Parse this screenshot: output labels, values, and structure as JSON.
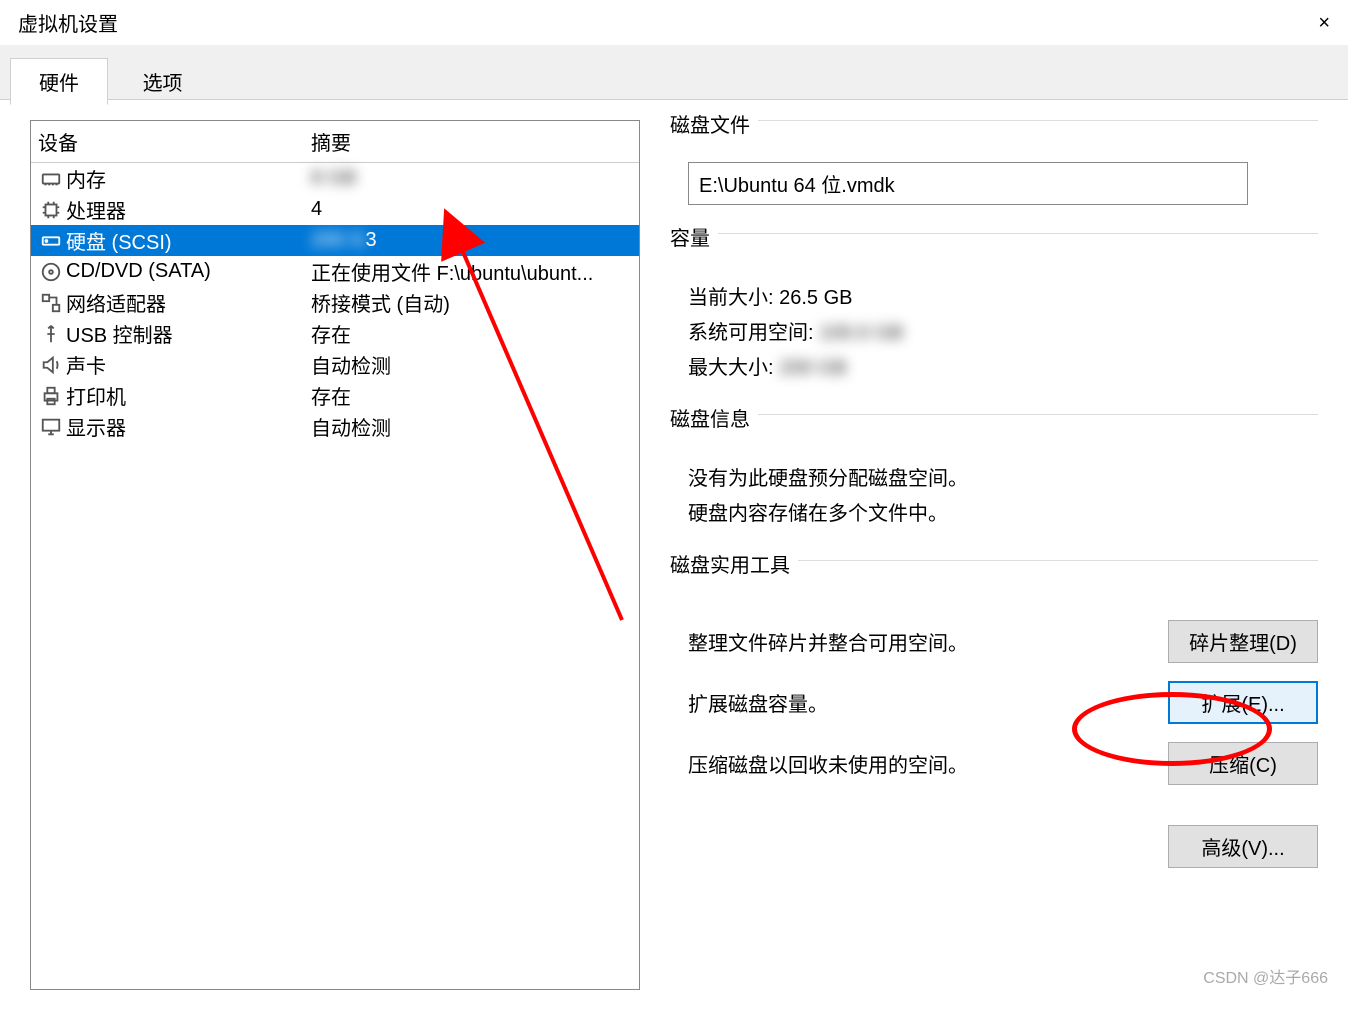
{
  "window": {
    "title": "虚拟机设置"
  },
  "tabs": {
    "hardware": "硬件",
    "options": "选项"
  },
  "devlist": {
    "header_device": "设备",
    "header_summary": "摘要",
    "items": [
      {
        "name": "内存",
        "summary": ""
      },
      {
        "name": "处理器",
        "summary": "4"
      },
      {
        "name": "硬盘 (SCSI)",
        "summary": "3"
      },
      {
        "name": "CD/DVD (SATA)",
        "summary": "正在使用文件 F:\\ubuntu\\ubunt..."
      },
      {
        "name": "网络适配器",
        "summary": "桥接模式 (自动)"
      },
      {
        "name": "USB 控制器",
        "summary": "存在"
      },
      {
        "name": "声卡",
        "summary": "自动检测"
      },
      {
        "name": "打印机",
        "summary": "存在"
      },
      {
        "name": "显示器",
        "summary": "自动检测"
      }
    ]
  },
  "right": {
    "disk_file_label": "磁盘文件",
    "disk_file_value": "E:\\Ubuntu 64 位.vmdk",
    "capacity_label": "容量",
    "cur_size_label": "当前大小:",
    "cur_size_value": "26.5 GB",
    "free_label": "系统可用空间:",
    "free_value": "",
    "max_label": "最大大小:",
    "max_value": "",
    "info_label": "磁盘信息",
    "info_line1": "没有为此硬盘预分配磁盘空间。",
    "info_line2": "硬盘内容存储在多个文件中。",
    "util_label": "磁盘实用工具",
    "util_defrag_desc": "整理文件碎片并整合可用空间。",
    "util_defrag_btn": "碎片整理(D)",
    "util_expand_desc": "扩展磁盘容量。",
    "util_expand_btn": "扩展(E)...",
    "util_compact_desc": "压缩磁盘以回收未使用的空间。",
    "util_compact_btn": "压缩(C)",
    "advanced_btn": "高级(V)..."
  },
  "watermark": "CSDN @达子666"
}
